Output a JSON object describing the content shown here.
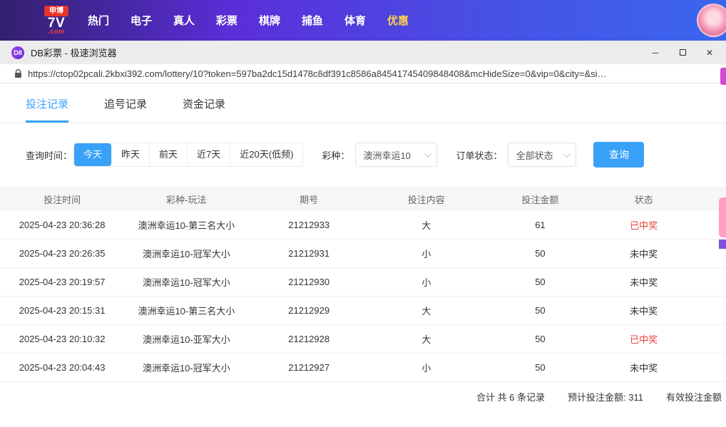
{
  "colors": {
    "accent_blue": "#3aa1f9",
    "win_red": "#e6413d",
    "lose_dark": "#333333",
    "nav_highlight_yellow": "#ffd24a",
    "navbar_gradient_start": "#33206f",
    "navbar_gradient_end": "#3a66ee",
    "logo_badge_red": "#e8342a",
    "floating_widget_magenta": "#d24ad2",
    "floating_widget_pink": "#ff9ec5",
    "floating_widget_purple": "#8050e0"
  },
  "site_nav": {
    "logo": {
      "badge": "申博",
      "main": "7V",
      "suffix": ".com"
    },
    "items": [
      "热门",
      "电子",
      "真人",
      "彩票",
      "棋牌",
      "捕鱼",
      "体育",
      "优惠"
    ],
    "highlight_index": 7
  },
  "browser": {
    "favicon_text": "D8",
    "title": "DB彩票 - 极速浏览器",
    "minimize_glyph": "─",
    "close_glyph": "✕",
    "url": "https://ctop02pcali.2kbxi392.com/lottery/10?token=597ba2dc15d1478c8df391c8586a84541745409848408&mcHideSize=0&vip=0&city=&si…"
  },
  "tabs": [
    {
      "label": "投注记录",
      "active": true
    },
    {
      "label": "追号记录",
      "active": false
    },
    {
      "label": "资金记录",
      "active": false
    }
  ],
  "filters": {
    "time_label": "查询时间：",
    "time_options": [
      "今天",
      "昨天",
      "前天",
      "近7天",
      "近20天(低频)"
    ],
    "time_active_index": 0,
    "lottery_label": "彩种：",
    "lottery_value": "澳洲幸运10",
    "status_label": "订单状态：",
    "status_value": "全部状态",
    "search_button": "查询"
  },
  "table": {
    "headers": [
      "投注时间",
      "彩种-玩法",
      "期号",
      "投注内容",
      "投注金额",
      "状态"
    ],
    "rows": [
      {
        "time": "2025-04-23 20:36:28",
        "play": "澳洲幸运10-第三名大小",
        "issue": "21212933",
        "content": "大",
        "amount": "61",
        "status": "已中奖",
        "status_color": "#e6413d"
      },
      {
        "time": "2025-04-23 20:26:35",
        "play": "澳洲幸运10-冠军大小",
        "issue": "21212931",
        "content": "小",
        "amount": "50",
        "status": "未中奖",
        "status_color": "#333333"
      },
      {
        "time": "2025-04-23 20:19:57",
        "play": "澳洲幸运10-冠军大小",
        "issue": "21212930",
        "content": "小",
        "amount": "50",
        "status": "未中奖",
        "status_color": "#333333"
      },
      {
        "time": "2025-04-23 20:15:31",
        "play": "澳洲幸运10-第三名大小",
        "issue": "21212929",
        "content": "大",
        "amount": "50",
        "status": "未中奖",
        "status_color": "#333333"
      },
      {
        "time": "2025-04-23 20:10:32",
        "play": "澳洲幸运10-亚军大小",
        "issue": "21212928",
        "content": "大",
        "amount": "50",
        "status": "已中奖",
        "status_color": "#e6413d"
      },
      {
        "time": "2025-04-23 20:04:43",
        "play": "澳洲幸运10-冠军大小",
        "issue": "21212927",
        "content": "小",
        "amount": "50",
        "status": "未中奖",
        "status_color": "#333333"
      }
    ]
  },
  "summary": {
    "record_count": "合计 共 6 条记录",
    "expected_amount": "预计投注金额: 311",
    "valid_amount_label": "有效投注金额"
  }
}
